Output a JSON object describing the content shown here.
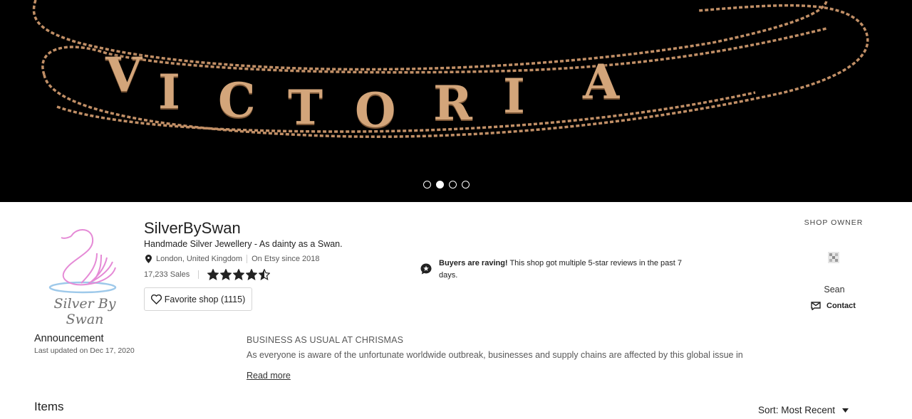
{
  "hero": {
    "letters": [
      "V",
      "I",
      "C",
      "T",
      "O",
      "R",
      "I",
      "A"
    ],
    "slides": 4,
    "active_slide": 2
  },
  "shop": {
    "logo_text": "Silver By Swan",
    "name": "SilverBySwan",
    "tagline": "Handmade Silver Jewellery - As dainty as a Swan.",
    "location": "London, United Kingdom",
    "since": "On Etsy since 2018",
    "sales": "17,233 Sales",
    "rating": 4.5,
    "favorite_label": "Favorite shop (1115)"
  },
  "raving": {
    "bold": "Buyers are raving!",
    "text": " This shop got multiple 5-star reviews in the past 7 days."
  },
  "owner": {
    "label": "SHOP OWNER",
    "name": "Sean",
    "contact_label": "Contact"
  },
  "announcement": {
    "title": "Announcement",
    "updated": "Last updated on Dec 17, 2020",
    "heading": "BUSINESS AS USUAL AT CHRISMAS",
    "body": "As everyone is aware of the unfortunate worldwide outbreak, businesses and supply chains are affected by this global issue in",
    "read_more": "Read more"
  },
  "items": {
    "title": "Items",
    "sort_label": "Sort: Most Recent"
  },
  "colors": {
    "gold": "#d3a57a",
    "logo_pink": "#e58ad6",
    "logo_blue": "#9ec9ea"
  }
}
